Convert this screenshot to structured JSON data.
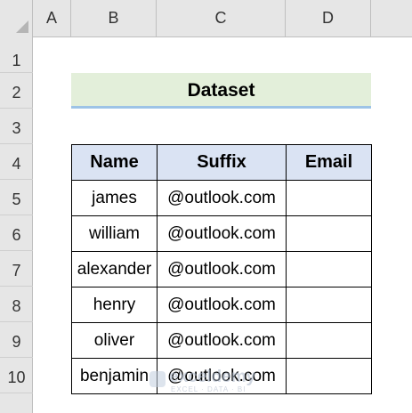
{
  "columns": [
    "A",
    "B",
    "C",
    "D"
  ],
  "rows": [
    "1",
    "2",
    "3",
    "4",
    "5",
    "6",
    "7",
    "8",
    "9",
    "10"
  ],
  "title": "Dataset",
  "table": {
    "headers": [
      "Name",
      "Suffix",
      "Email"
    ],
    "rows": [
      {
        "name": "james",
        "suffix": "@outlook.com",
        "email": ""
      },
      {
        "name": "william",
        "suffix": "@outlook.com",
        "email": ""
      },
      {
        "name": "alexander",
        "suffix": "@outlook.com",
        "email": ""
      },
      {
        "name": "henry",
        "suffix": "@outlook.com",
        "email": ""
      },
      {
        "name": "oliver",
        "suffix": "@outlook.com",
        "email": ""
      },
      {
        "name": "benjamin",
        "suffix": "@outlook.com",
        "email": ""
      }
    ]
  },
  "watermark": {
    "name": "exceldemy",
    "tagline": "EXCEL · DATA · BI"
  },
  "colors": {
    "title_bg": "#e3efda",
    "header_bg": "#dae3f3",
    "title_underline": "#9dc3e6"
  }
}
